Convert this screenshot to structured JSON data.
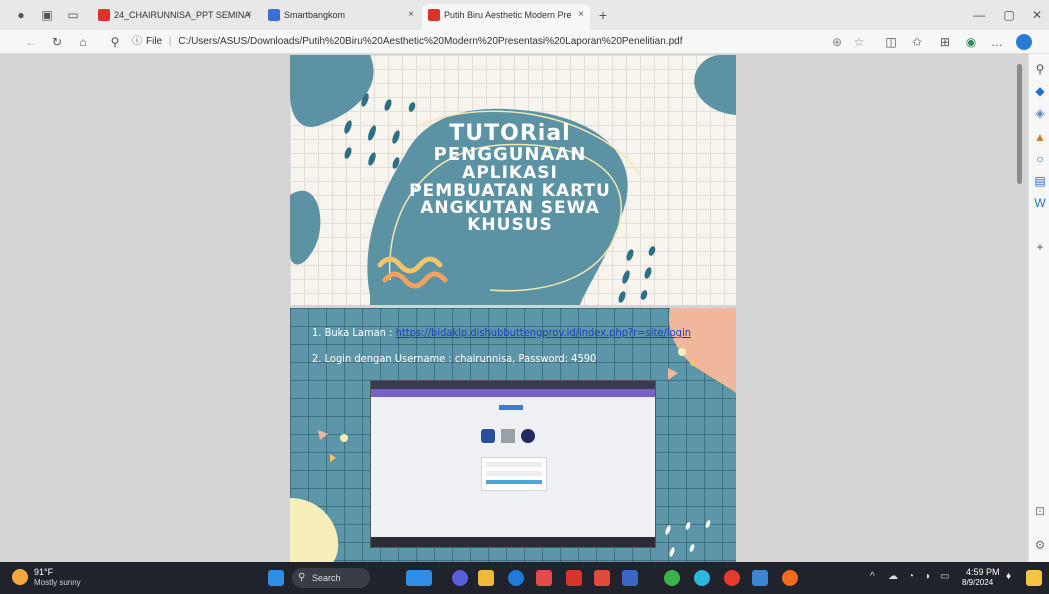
{
  "browser": {
    "tabs": [
      {
        "label": "24_CHAIRUNNISA_PPT SEMINA"
      },
      {
        "label": "Smartbangkom"
      },
      {
        "label": "Putih Biru Aesthetic Modern Pre"
      }
    ],
    "new_tab": "+",
    "address": {
      "info": "File",
      "url": "C:/Users/ASUS/Downloads/Putih%20Biru%20Aesthetic%20Modern%20Presentasi%20Laporan%20Penelitian.pdf"
    },
    "window_controls": {
      "minimize": "—",
      "maximize": "▢",
      "close": "✕"
    }
  },
  "slide1": {
    "title_lines": [
      "TUTORial",
      "PENGGUNAAN",
      "APLIKASI",
      "PEMBUATAN KARTU",
      "ANGKUTAN SEWA",
      "KHUSUS"
    ]
  },
  "slide2": {
    "step1_label": "1. Buka Laman : ",
    "step1_link": "https://bidaklp.dishubbuttengprov.id/index.php?r=site/login",
    "step2_label": "2. Login dengan Username : chairunnisa, Password: 4590"
  },
  "taskbar": {
    "weather_temp": "91°F",
    "weather_desc": "Mostly sunny",
    "search_placeholder": "Search",
    "time": "4:59 PM",
    "date": "8/9/2024"
  },
  "colors": {
    "slide_teal": "#5c96a8",
    "blob_teal": "#5b93a4",
    "accent_peach": "#f0b79c",
    "accent_yellow": "#f3d27a"
  }
}
